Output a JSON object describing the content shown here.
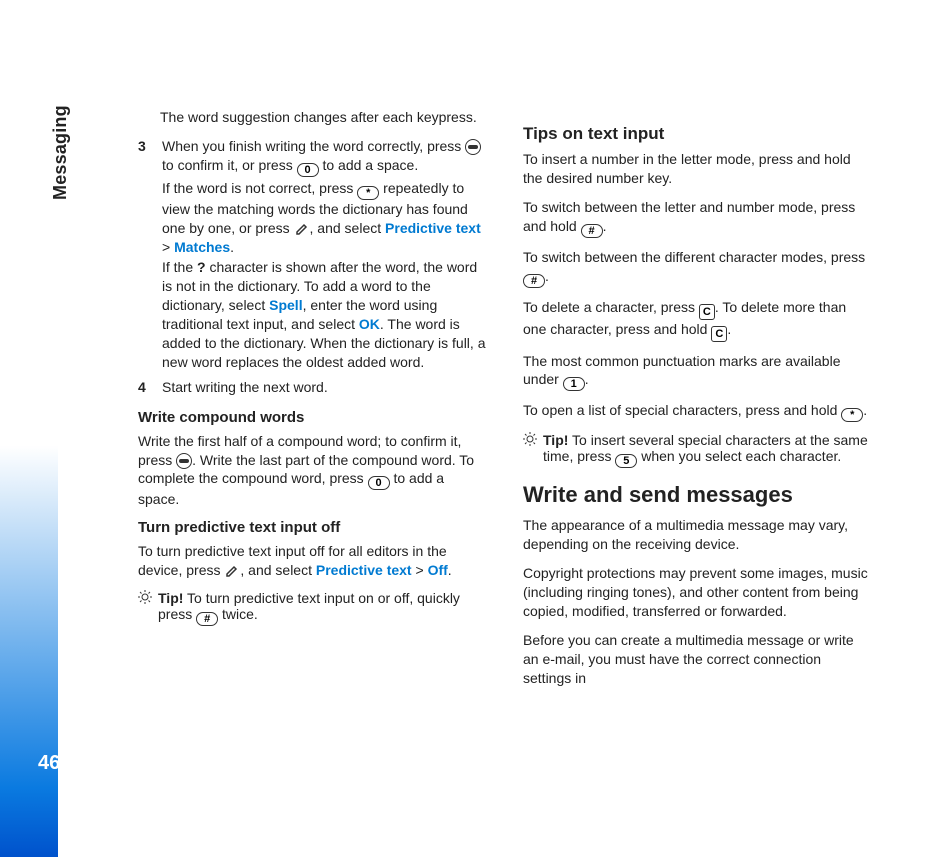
{
  "section": "Messaging",
  "page_number": "46",
  "links": {
    "predictive": "Predictive text",
    "matches": "Matches",
    "spell": "Spell",
    "ok": "OK",
    "off": "Off"
  },
  "keys": {
    "zero": "0",
    "star": "*",
    "hash": "#",
    "one": "1",
    "five": "5",
    "clear": "C"
  },
  "col1": {
    "intro": "The word suggestion changes after each keypress.",
    "step3_num": "3",
    "s3_a1": "When you finish writing the word correctly, press ",
    "s3_a2": " to confirm it, or press ",
    "s3_a3": " to add a space.",
    "s3_b1": "If the word is not correct, press ",
    "s3_b2": " repeatedly to view the matching words the dictionary has found one by one, or press ",
    "s3_b3": ", and select ",
    "s3_b4": " > ",
    "s3_b5": ".",
    "s3_c1": "If the ",
    "s3_c_q": "?",
    "s3_c2": " character is shown after the word, the word is not in the dictionary. To add a word to the dictionary, select ",
    "s3_c3": ", enter the word using traditional text input, and select ",
    "s3_c4": ". The word is added to the dictionary. When the dictionary is full, a new word replaces the oldest added word.",
    "step4_num": "4",
    "step4": "Start writing the next word.",
    "h_compound": "Write compound words",
    "comp_p1": "Write the first half of a compound word; to confirm it, press ",
    "comp_p2": ". Write the last part of the compound word. To complete the compound word, press ",
    "comp_p3": " to add a space.",
    "h_turnoff": "Turn predictive text input off",
    "to_p1": "To turn predictive text input off for all editors in the device, press ",
    "to_p2": ", and select ",
    "to_p3": " > ",
    "to_p4": ".",
    "tip_lbl": "Tip!",
    "tip1_a": " To turn predictive text input on or off, quickly press ",
    "tip1_b": " twice."
  },
  "col2": {
    "h_tips": "Tips on text input",
    "t1": "To insert a number in the letter mode, press and hold the desired number key.",
    "t2a": "To switch between the letter and number mode, press and hold ",
    "t2b": ".",
    "t3a": "To switch between the different character modes, press ",
    "t3b": ".",
    "t4a": "To delete a character, press ",
    "t4b": ". To delete more than one character, press and hold ",
    "t4c": ".",
    "t5a": "The most common punctuation marks are available under ",
    "t5b": ".",
    "t6a": "To open a list of special characters, press and hold ",
    "t6b": ".",
    "tip2_a": " To insert several special characters at the same time, press ",
    "tip2_b": " when you select each character.",
    "h_writesend": "Write and send messages",
    "ws1": "The appearance of a multimedia message may vary, depending on the receiving device.",
    "ws2": "Copyright protections may prevent some images, music (including ringing tones), and other content from being copied, modified, transferred or forwarded.",
    "ws3": "Before you can create a multimedia message or write an e-mail, you must have the correct connection settings in"
  }
}
